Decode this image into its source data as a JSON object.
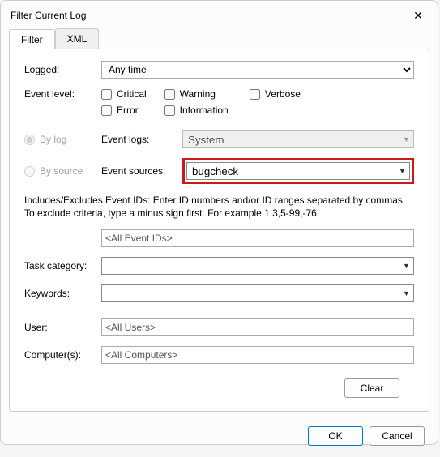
{
  "window": {
    "title": "Filter Current Log"
  },
  "tabs": {
    "filter": "Filter",
    "xml": "XML"
  },
  "labels": {
    "logged": "Logged:",
    "event_level": "Event level:",
    "by_log": "By log",
    "by_source": "By source",
    "event_logs": "Event logs:",
    "event_sources": "Event sources:",
    "task_category": "Task category:",
    "keywords": "Keywords:",
    "user": "User:",
    "computers": "Computer(s):"
  },
  "values": {
    "logged": "Any time",
    "event_logs": "System",
    "event_sources": "bugcheck",
    "event_ids": "<All Event IDs>",
    "task_category": "",
    "keywords": "",
    "user": "<All Users>",
    "computers": "<All Computers>"
  },
  "checkboxes": {
    "critical": "Critical",
    "warning": "Warning",
    "verbose": "Verbose",
    "error": "Error",
    "information": "Information"
  },
  "desc": "Includes/Excludes Event IDs: Enter ID numbers and/or ID ranges separated by commas. To exclude criteria, type a minus sign first. For example 1,3,5-99,-76",
  "buttons": {
    "clear": "Clear",
    "ok": "OK",
    "cancel": "Cancel"
  }
}
